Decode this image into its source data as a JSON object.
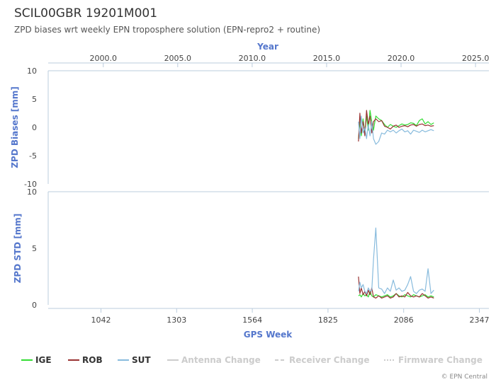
{
  "chart_data": {
    "type": "line",
    "title": "SCIL00GBR 19201M001",
    "subtitle": "ZPD biases wrt weekly EPN troposphere solution (EPN-repro2 + routine)",
    "top_axis": {
      "label": "Year",
      "range": [
        1996.3,
        2025.9
      ],
      "ticks": [
        "2000.0",
        "2005.0",
        "2010.0",
        "2015.0",
        "2020.0",
        "2025.0"
      ]
    },
    "bottom_axis": {
      "label": "GPS Week",
      "range": [
        860,
        2380
      ],
      "ticks": [
        "1042",
        "1303",
        "1564",
        "1825",
        "2086",
        "2347"
      ]
    },
    "panels": [
      {
        "ylabel": "ZPD Biases [mm]",
        "ylim": [
          -10,
          10
        ],
        "yticks": [
          "10",
          "5",
          "0",
          "-5",
          "-10"
        ],
        "series": [
          {
            "name": "IGE",
            "color": "#33dd33",
            "x": [
              1930,
              1935,
              1940,
              1946,
              1952,
              1958,
              1964,
              1970,
              1976,
              1982,
              1990,
              2000,
              2010,
              2020,
              2030,
              2040,
              2050,
              2060,
              2070,
              2080,
              2090,
              2100,
              2110,
              2120,
              2130,
              2140,
              2150,
              2160,
              2170,
              2180,
              2190
            ],
            "y": [
              -2,
              1,
              -1.5,
              1.5,
              -1,
              2,
              -0.5,
              3,
              1,
              -0.5,
              2,
              1.5,
              1.2,
              0.5,
              0,
              0.5,
              0.2,
              0,
              0.3,
              0.6,
              0.4,
              0.5,
              0.8,
              0.7,
              0.3,
              1.2,
              1.5,
              0.6,
              1.0,
              0.5,
              0.8
            ]
          },
          {
            "name": "ROB",
            "color": "#993333",
            "x": [
              1930,
              1935,
              1940,
              1946,
              1952,
              1958,
              1964,
              1970,
              1976,
              1982,
              1990,
              2000,
              2010,
              2020,
              2030,
              2040,
              2050,
              2060,
              2070,
              2080,
              2090,
              2100,
              2110,
              2120,
              2130,
              2140,
              2150,
              2160,
              2170,
              2180,
              2190
            ],
            "y": [
              -2.5,
              2.5,
              -1,
              1,
              -1.5,
              3,
              0.5,
              2,
              -1,
              1,
              1.5,
              1,
              1.2,
              0.2,
              0,
              -0.3,
              0.2,
              0.4,
              0,
              0.2,
              0.3,
              0.1,
              0.4,
              0.5,
              0.2,
              0.5,
              0.6,
              0.3,
              0.4,
              0.2,
              0.3
            ]
          },
          {
            "name": "SUT",
            "color": "#88bbdd",
            "x": [
              1930,
              1935,
              1940,
              1946,
              1952,
              1958,
              1964,
              1970,
              1976,
              1982,
              1990,
              2000,
              2010,
              2020,
              2030,
              2040,
              2050,
              2060,
              2070,
              2080,
              2090,
              2100,
              2110,
              2120,
              2130,
              2140,
              2150,
              2160,
              2170,
              2180,
              2190
            ],
            "y": [
              1,
              -2,
              2,
              -1,
              0,
              -2,
              0.5,
              -1.5,
              1,
              -2,
              -3,
              -2.5,
              -1,
              -1.2,
              -0.5,
              -0.8,
              -0.5,
              -1,
              -0.6,
              -0.3,
              -0.8,
              -0.6,
              -1.2,
              -0.5,
              -0.7,
              -0.9,
              -0.5,
              -0.8,
              -0.6,
              -0.4,
              -0.6
            ]
          }
        ]
      },
      {
        "ylabel": "ZPD STD [mm]",
        "ylim": [
          0,
          10
        ],
        "yticks": [
          "10",
          "5",
          "0"
        ],
        "series": [
          {
            "name": "IGE",
            "color": "#33dd33",
            "x": [
              1930,
              1935,
              1940,
              1946,
              1952,
              1958,
              1964,
              1970,
              1976,
              1982,
              1990,
              2000,
              2010,
              2020,
              2030,
              2040,
              2050,
              2060,
              2070,
              2080,
              2090,
              2100,
              2110,
              2120,
              2130,
              2140,
              2150,
              2160,
              2170,
              2180,
              2190
            ],
            "y": [
              0.8,
              0.9,
              0.7,
              1.0,
              0.8,
              0.9,
              0.7,
              1.2,
              0.8,
              0.7,
              0.9,
              0.8,
              0.7,
              0.8,
              0.9,
              0.7,
              0.8,
              1.0,
              0.8,
              0.7,
              0.9,
              0.8,
              0.7,
              0.9,
              0.8,
              0.7,
              0.8,
              0.9,
              0.7,
              0.8,
              0.7
            ]
          },
          {
            "name": "ROB",
            "color": "#993333",
            "x": [
              1930,
              1935,
              1940,
              1946,
              1952,
              1958,
              1964,
              1970,
              1976,
              1982,
              1990,
              2000,
              2010,
              2020,
              2030,
              2040,
              2050,
              2060,
              2070,
              2080,
              2090,
              2100,
              2110,
              2120,
              2130,
              2140,
              2150,
              2160,
              2170,
              2180,
              2190
            ],
            "y": [
              2.5,
              1.0,
              1.5,
              0.9,
              1.2,
              0.8,
              1.3,
              0.9,
              1.5,
              0.7,
              0.6,
              0.8,
              0.6,
              0.7,
              0.8,
              0.6,
              0.7,
              1.0,
              0.7,
              0.8,
              0.7,
              1.1,
              0.8,
              0.7,
              0.8,
              0.7,
              1.0,
              0.8,
              0.6,
              0.7,
              0.6
            ]
          },
          {
            "name": "SUT",
            "color": "#88bbdd",
            "x": [
              1930,
              1935,
              1940,
              1946,
              1952,
              1958,
              1964,
              1970,
              1976,
              1982,
              1990,
              2000,
              2010,
              2020,
              2030,
              2040,
              2050,
              2060,
              2070,
              2080,
              2090,
              2100,
              2110,
              2120,
              2130,
              2140,
              2150,
              2160,
              2170,
              2180,
              2190
            ],
            "y": [
              1.2,
              2.0,
              1.5,
              1.8,
              1.2,
              1.0,
              1.5,
              1.2,
              1.3,
              4.0,
              6.8,
              1.5,
              1.4,
              1.0,
              1.5,
              1.2,
              2.2,
              1.3,
              1.5,
              1.2,
              1.3,
              1.8,
              2.5,
              1.2,
              1.0,
              1.3,
              1.4,
              1.2,
              3.2,
              1.0,
              1.3
            ]
          }
        ]
      }
    ],
    "legend": {
      "placement": "bottom",
      "items": [
        {
          "name": "IGE",
          "color": "#33dd33",
          "active": true,
          "dash": "solid"
        },
        {
          "name": "ROB",
          "color": "#993333",
          "active": true,
          "dash": "solid"
        },
        {
          "name": "SUT",
          "color": "#88bbdd",
          "active": true,
          "dash": "solid"
        },
        {
          "name": "Antenna Change",
          "color": "#cccccc",
          "active": false,
          "dash": "solid"
        },
        {
          "name": "Receiver Change",
          "color": "#cccccc",
          "active": false,
          "dash": "dashed"
        },
        {
          "name": "Firmware Change",
          "color": "#cccccc",
          "active": false,
          "dash": "dotted"
        }
      ]
    },
    "credits": "© EPN Central"
  }
}
